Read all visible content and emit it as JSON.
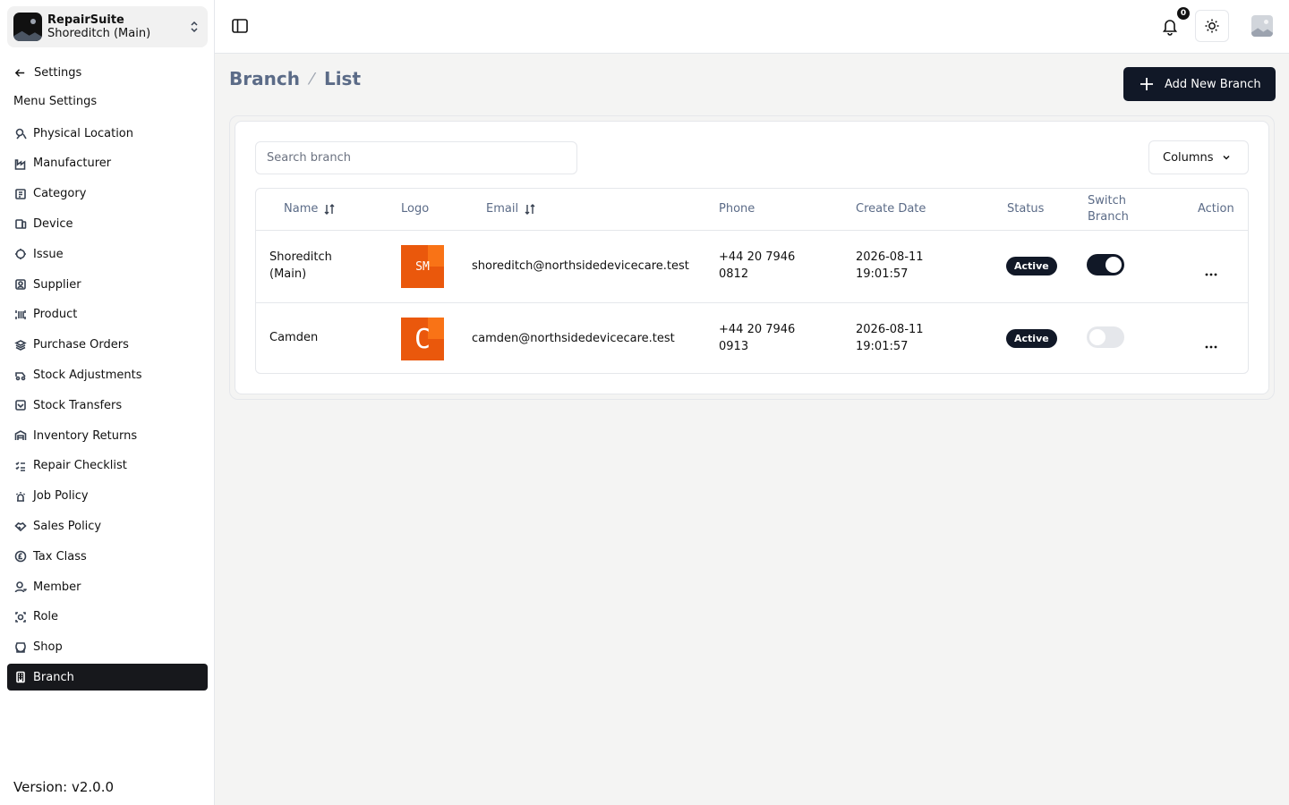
{
  "brand": {
    "name": "RepairSuite",
    "branch": "Shoreditch (Main)"
  },
  "nav": {
    "back_label": "Settings",
    "section_label": "Menu Settings",
    "items": [
      {
        "label": "Physical Location",
        "icon": "location-icon"
      },
      {
        "label": "Manufacturer",
        "icon": "factory-icon"
      },
      {
        "label": "Category",
        "icon": "category-icon"
      },
      {
        "label": "Device",
        "icon": "device-icon"
      },
      {
        "label": "Issue",
        "icon": "issue-icon"
      },
      {
        "label": "Supplier",
        "icon": "supplier-icon"
      },
      {
        "label": "Product",
        "icon": "product-icon"
      },
      {
        "label": "Purchase Orders",
        "icon": "layers-icon"
      },
      {
        "label": "Stock Adjustments",
        "icon": "adjust-icon"
      },
      {
        "label": "Stock Transfers",
        "icon": "transfer-icon"
      },
      {
        "label": "Inventory Returns",
        "icon": "warehouse-icon"
      },
      {
        "label": "Repair Checklist",
        "icon": "checklist-icon"
      },
      {
        "label": "Job Policy",
        "icon": "policy-icon"
      },
      {
        "label": "Sales Policy",
        "icon": "handshake-icon"
      },
      {
        "label": "Tax Class",
        "icon": "currency-icon"
      },
      {
        "label": "Member",
        "icon": "user-icon"
      },
      {
        "label": "Role",
        "icon": "role-icon"
      },
      {
        "label": "Shop",
        "icon": "store-icon"
      },
      {
        "label": "Branch",
        "icon": "building-icon",
        "active": true
      }
    ]
  },
  "version": "Version: v2.0.0",
  "topbar": {
    "notification_count": "0"
  },
  "breadcrumb": {
    "section": "Branch",
    "page": "List"
  },
  "actions": {
    "add_label": "Add New Branch",
    "columns_label": "Columns"
  },
  "search": {
    "placeholder": "Search branch",
    "value": ""
  },
  "table": {
    "headers": {
      "name": "Name",
      "logo": "Logo",
      "email": "Email",
      "phone": "Phone",
      "create_date": "Create Date",
      "status": "Status",
      "switch_branch": "Switch Branch",
      "action": "Action"
    },
    "rows": [
      {
        "name": "Shoreditch (Main)",
        "logo_text": "SM",
        "email": "shoreditch@northsidedevicecare.test",
        "phone": "+44 20 7946 0812",
        "create_date": "2026-08-11 19:01:57",
        "status": "Active",
        "switch_on": true
      },
      {
        "name": "Camden",
        "logo_text": "C",
        "email": "camden@northsidedevicecare.test",
        "phone": "+44 20 7946 0913",
        "create_date": "2026-08-11 19:01:57",
        "status": "Active",
        "switch_on": false
      }
    ]
  },
  "colors": {
    "primary": "#111827",
    "logo_orange": "#ea580c",
    "muted_text": "#5b6b87"
  }
}
